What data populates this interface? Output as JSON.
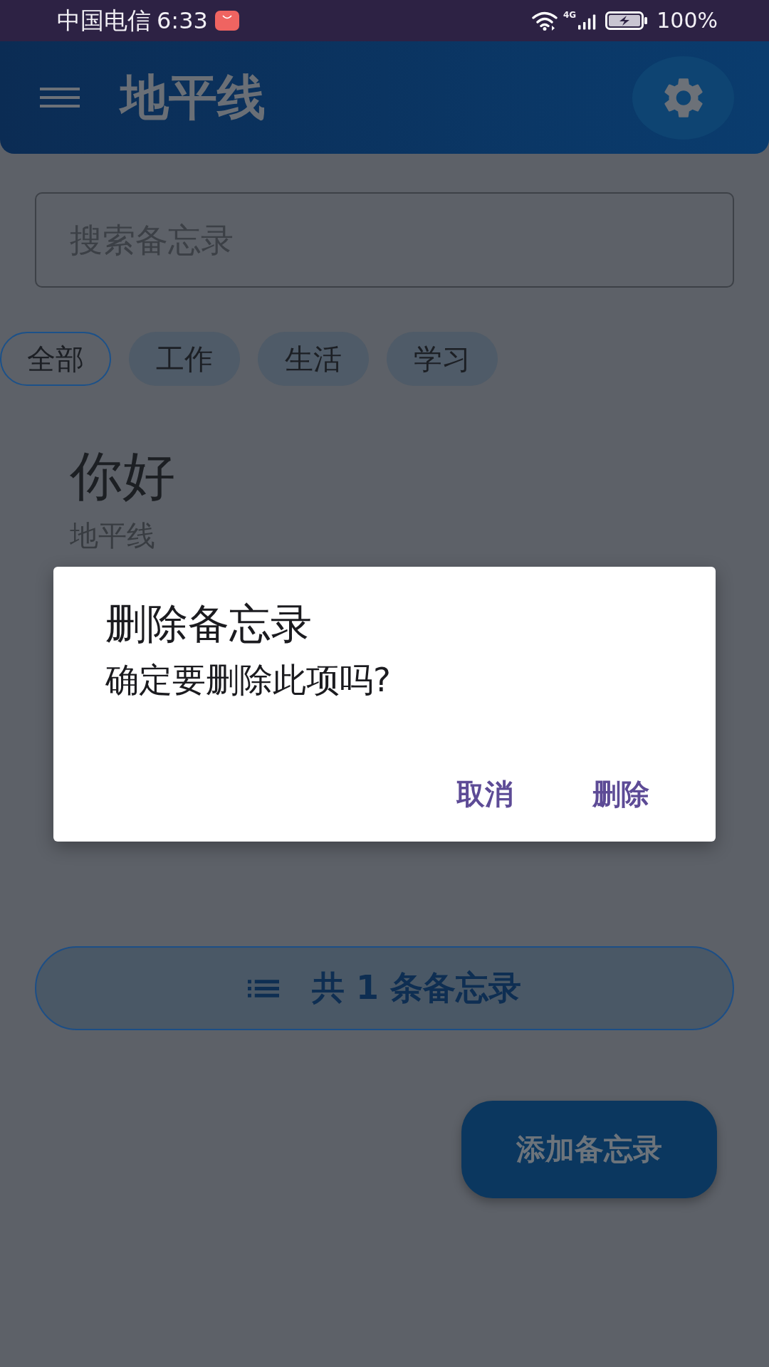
{
  "status_bar": {
    "carrier": "中国电信",
    "time": "6:33",
    "network": "4G",
    "battery": "100%",
    "charging": true
  },
  "app_bar": {
    "title": "地平线"
  },
  "search": {
    "placeholder": "搜索备忘录"
  },
  "filter_chips": [
    {
      "label": "全部",
      "selected": true
    },
    {
      "label": "工作",
      "selected": false
    },
    {
      "label": "生活",
      "selected": false
    },
    {
      "label": "学习",
      "selected": false
    }
  ],
  "notes": [
    {
      "title": "你好",
      "subtitle": "地平线"
    }
  ],
  "summary_button": {
    "label": "共 1 条备忘录"
  },
  "fab": {
    "label": "添加备忘录"
  },
  "dialog": {
    "title": "删除备忘录",
    "message": "确定要删除此项吗?",
    "buttons": [
      {
        "label": "取消"
      },
      {
        "label": "删除"
      }
    ]
  }
}
